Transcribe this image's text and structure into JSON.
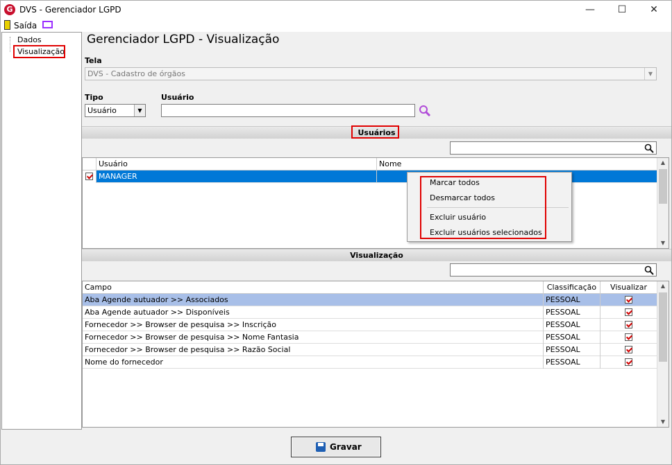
{
  "window": {
    "title": "DVS - Gerenciador LGPD",
    "logo_letter": "G",
    "minimize": "—",
    "maximize": "☐",
    "close": "✕"
  },
  "menu": {
    "exit_label": "Saída"
  },
  "tree": {
    "items": [
      {
        "label": "Dados"
      },
      {
        "label": "Visualização"
      }
    ]
  },
  "page": {
    "title": "Gerenciador LGPD - Visualização"
  },
  "form": {
    "tela_label": "Tela",
    "tela_value": "DVS - Cadastro de órgãos",
    "tipo_label": "Tipo",
    "tipo_value": "Usuário",
    "usuario_label": "Usuário",
    "usuario_value": ""
  },
  "usuarios_section": {
    "title": "Usuários",
    "columns": [
      "Usuário",
      "Nome"
    ],
    "rows": [
      {
        "usuario": "MANAGER",
        "nome": "",
        "checked": true,
        "selected": true
      }
    ]
  },
  "context_menu": {
    "items": [
      "Marcar todos",
      "Desmarcar todos",
      "Excluir usuário",
      "Excluir usuários selecionados"
    ]
  },
  "visualizacao_section": {
    "title": "Visualização",
    "columns": [
      "Campo",
      "Classificação",
      "Visualizar"
    ],
    "rows": [
      {
        "campo": "Aba Agende autuador >> Associados",
        "classificacao": "PESSOAL",
        "visualizar": true,
        "selected": true
      },
      {
        "campo": "Aba Agende autuador >> Disponíveis",
        "classificacao": "PESSOAL",
        "visualizar": true
      },
      {
        "campo": "Fornecedor >> Browser de pesquisa >> Inscrição",
        "classificacao": "PESSOAL",
        "visualizar": true
      },
      {
        "campo": "Fornecedor >> Browser de pesquisa >> Nome Fantasia",
        "classificacao": "PESSOAL",
        "visualizar": true
      },
      {
        "campo": "Fornecedor >> Browser de pesquisa >> Razão Social",
        "classificacao": "PESSOAL",
        "visualizar": true
      },
      {
        "campo": "Nome do fornecedor",
        "classificacao": "PESSOAL",
        "visualizar": true
      }
    ]
  },
  "footer": {
    "save_label": "Gravar"
  },
  "colors": {
    "selection": "#0078d7",
    "highlight_box": "#e00000",
    "row_selected": "#a8bfe8"
  },
  "icons": {
    "search": "search-icon",
    "save": "floppy-disk-icon",
    "exit": "door-exit-icon",
    "monitor": "monitor-icon"
  }
}
